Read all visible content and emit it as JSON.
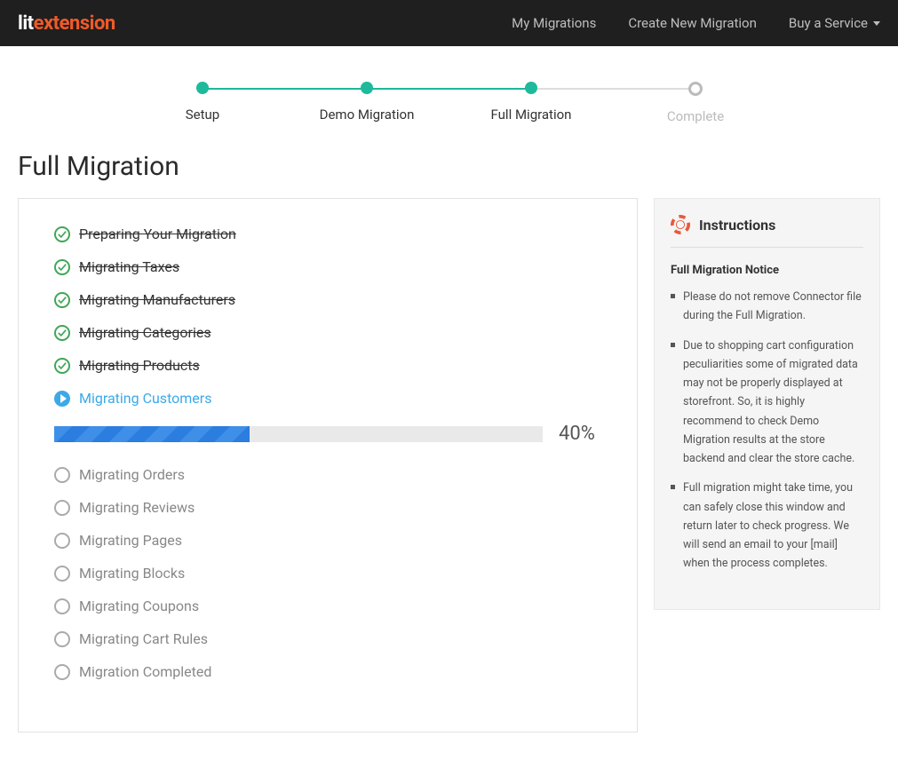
{
  "logo": {
    "part1": "lit",
    "part2": "extension"
  },
  "nav": {
    "my_migrations": "My Migrations",
    "create_new": "Create New Migration",
    "buy_service": "Buy a Service"
  },
  "steps": {
    "setup": "Setup",
    "demo": "Demo Migration",
    "full": "Full Migration",
    "complete": "Complete"
  },
  "page_title": "Full Migration",
  "tasks": {
    "done": [
      "Preparing Your Migration",
      "Migrating Taxes",
      "Migrating Manufacturers",
      "Migrating Categories",
      "Migrating Products"
    ],
    "current": "Migrating Customers",
    "pending": [
      "Migrating Orders",
      "Migrating Reviews",
      "Migrating Pages",
      "Migrating Blocks",
      "Migrating Coupons",
      "Migrating Cart Rules",
      "Migration Completed"
    ]
  },
  "progress": {
    "percent": 40,
    "percent_label": "40%"
  },
  "sidebar": {
    "title": "Instructions",
    "notice_title": "Full Migration Notice",
    "notices": [
      "Please do not remove Connector file during the Full Migration.",
      "Due to shopping cart configuration peculiarities some of migrated data may not be properly displayed at storefront. So, it is highly recommend to check Demo Migration results at the store backend and clear the store cache.",
      "Full migration might take time, you can safely close this window and return later to check progress. We will send an email to your [mail] when the process completes."
    ]
  }
}
